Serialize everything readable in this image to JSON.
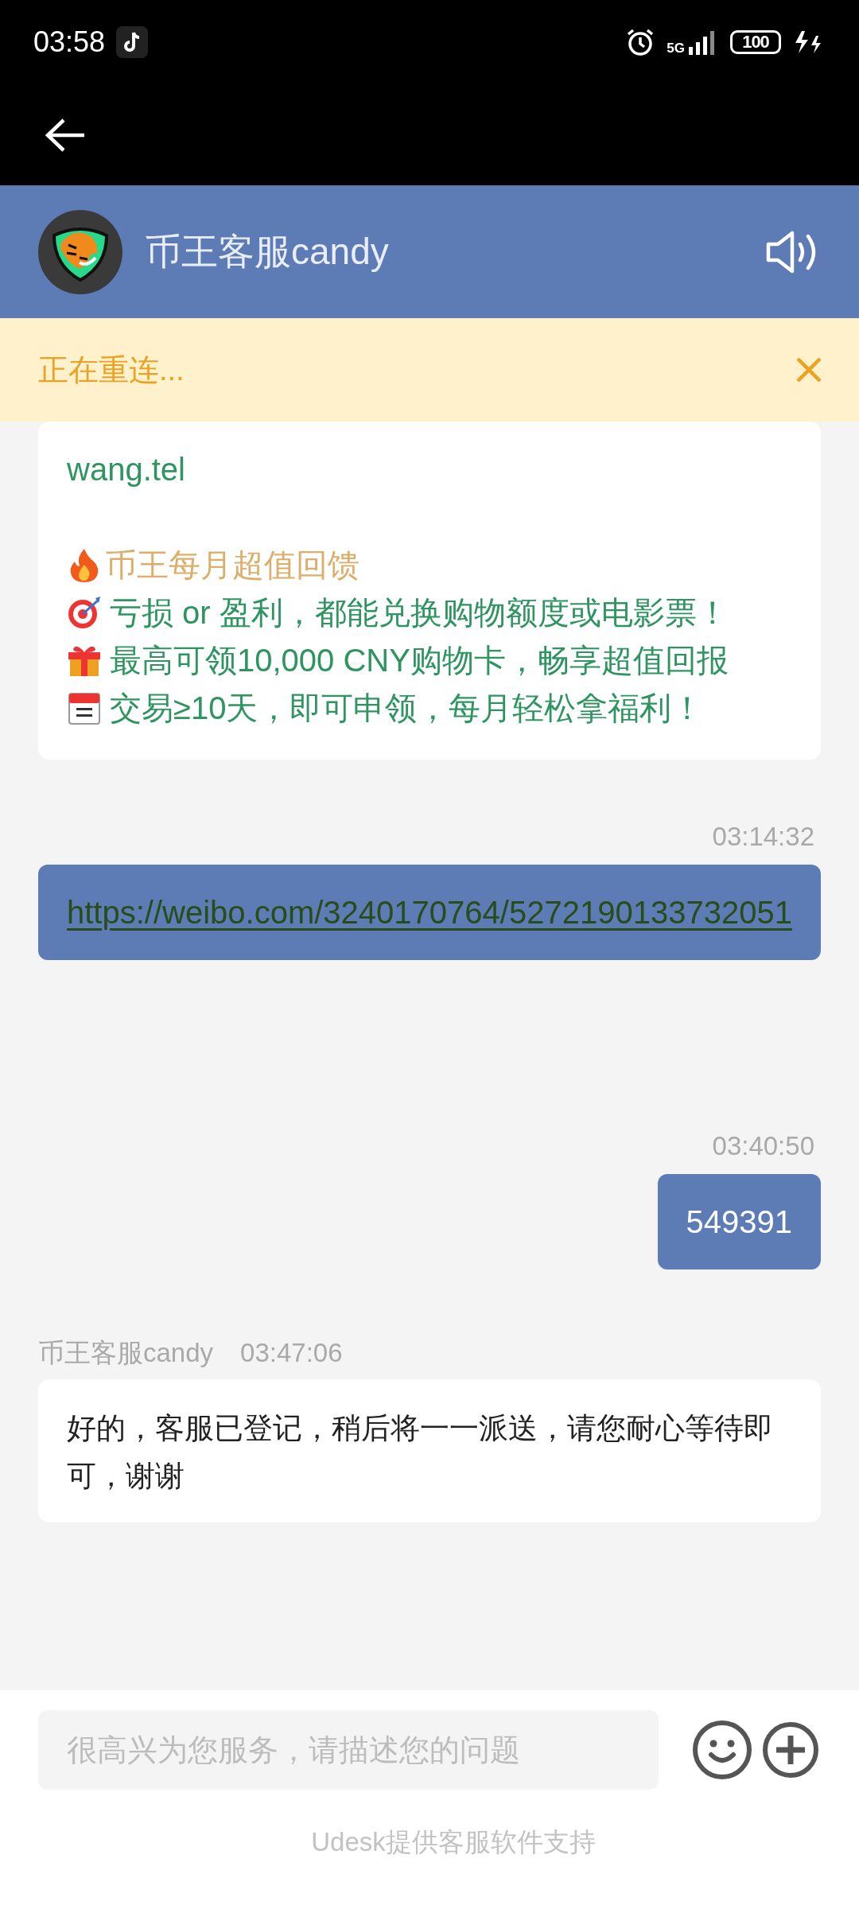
{
  "status_bar": {
    "time": "03:58",
    "network": "5G",
    "battery": "100"
  },
  "header": {
    "title": "币王客服candy"
  },
  "banner": {
    "text": "正在重连..."
  },
  "messages": [
    {
      "kind": "card",
      "lines": [
        {
          "kind": "link",
          "text": "wang.tel"
        },
        {
          "kind": "gap"
        },
        {
          "kind": "highlight",
          "text": "币王每月超值回馈"
        },
        {
          "kind": "target",
          "text": "亏损 or 盈利，都能兑换购物额度或电影票！"
        },
        {
          "kind": "gift",
          "text": "最高可领10,000 CNY购物卡，畅享超值回报"
        },
        {
          "kind": "calendar",
          "text": "交易≥10天，即可申领，每月轻松拿福利！"
        }
      ]
    },
    {
      "kind": "outgoing",
      "time": "03:14:32",
      "text": "https://weibo.com/3240170764/5272190133732051",
      "link": true
    },
    {
      "kind": "outgoing",
      "time": "03:40:50",
      "text": "549391",
      "link": false
    },
    {
      "kind": "incoming",
      "sender": "币王客服candy",
      "time": "03:47:06",
      "text": "好的，客服已登记，稍后将一一派送，请您耐心等待即可，谢谢"
    }
  ],
  "composer": {
    "placeholder": "很高兴为您服务，请描述您的问题",
    "footer": "Udesk提供客服软件支持"
  }
}
